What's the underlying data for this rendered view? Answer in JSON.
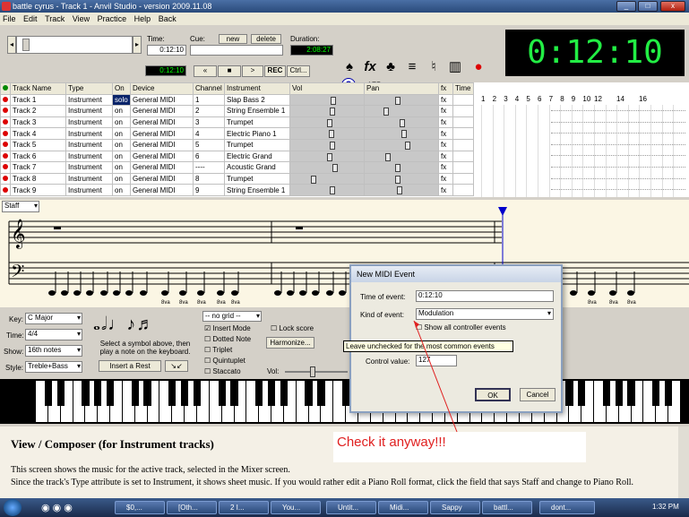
{
  "window": {
    "title": "battle cyrus - Track 1 - Anvil Studio - version 2009.11.08"
  },
  "menu": [
    "File",
    "Edit",
    "Track",
    "View",
    "Practice",
    "Help",
    "Back"
  ],
  "transport": {
    "time_label": "Time:",
    "time_value": "0:12:10",
    "cue_label": "Cue:",
    "cue_new": "new",
    "cue_delete": "delete",
    "duration_label": "Duration:",
    "duration_value": "2:08:27",
    "position_value": "0:12:10",
    "buttons": [
      "«",
      "■",
      ">",
      "REC",
      "Ctrl..."
    ],
    "tempo_value": "175",
    "tempo_label": "tempo",
    "big_clock": "0:12:10"
  },
  "mixer": {
    "headers": [
      "Track Name",
      "Type",
      "On",
      "Device",
      "Channel",
      "Instrument",
      "Vol",
      "Pan",
      "fx",
      "Time"
    ],
    "measures": [
      "1",
      "2",
      "3",
      "4",
      "5",
      "6",
      "7",
      "8",
      "9",
      "10",
      "12",
      "14",
      "16"
    ],
    "rows": [
      {
        "name": "Track 1",
        "type": "Instrument",
        "on": "solo",
        "device": "General MIDI",
        "channel": "1",
        "instrument": "Slap Bass 2",
        "fx": "fx",
        "vol": 0.6,
        "pan": 0.45
      },
      {
        "name": "Track 2",
        "type": "Instrument",
        "on": "on",
        "device": "General MIDI",
        "channel": "2",
        "instrument": "String Ensemble 1",
        "fx": "fx",
        "vol": 0.58,
        "pan": 0.28
      },
      {
        "name": "Track 3",
        "type": "Instrument",
        "on": "on",
        "device": "General MIDI",
        "channel": "3",
        "instrument": "Trumpet",
        "fx": "fx",
        "vol": 0.55,
        "pan": 0.52
      },
      {
        "name": "Track 4",
        "type": "Instrument",
        "on": "on",
        "device": "General MIDI",
        "channel": "4",
        "instrument": "Electric Piano 1",
        "fx": "fx",
        "vol": 0.57,
        "pan": 0.55
      },
      {
        "name": "Track 5",
        "type": "Instrument",
        "on": "on",
        "device": "General MIDI",
        "channel": "5",
        "instrument": "Trumpet",
        "fx": "fx",
        "vol": 0.58,
        "pan": 0.6
      },
      {
        "name": "Track 6",
        "type": "Instrument",
        "on": "on",
        "device": "General MIDI",
        "channel": "6",
        "instrument": "Electric Grand",
        "fx": "fx",
        "vol": 0.55,
        "pan": 0.3
      },
      {
        "name": "Track 7",
        "type": "Instrument",
        "on": "on",
        "device": "General MIDI",
        "channel": "----",
        "instrument": "Acoustic Grand",
        "fx": "fx",
        "vol": 0.62,
        "pan": 0.45
      },
      {
        "name": "Track 8",
        "type": "Instrument",
        "on": "on",
        "device": "General MIDI",
        "channel": "8",
        "instrument": "Trumpet",
        "fx": "fx",
        "vol": 0.3,
        "pan": 0.45
      },
      {
        "name": "Track 9",
        "type": "Instrument",
        "on": "on",
        "device": "General MIDI",
        "channel": "9",
        "instrument": "String Ensemble 1",
        "fx": "fx",
        "vol": 0.58,
        "pan": 0.48
      }
    ]
  },
  "staff": {
    "view_select": "Staff",
    "ottava": "8va"
  },
  "composer": {
    "key_label": "Key:",
    "key_value": "C Major",
    "time_label": "Time:",
    "time_value": "4/4",
    "show_label": "Show:",
    "show_value": "16th notes",
    "style_label": "Style:",
    "style_value": "Treble+Bass",
    "symbol_hint": "Select a symbol above, then play a note on the keyboard.",
    "insert_rest": "Insert a Rest",
    "grid_value": "-- no grid --",
    "lock_score": "Lock score",
    "insert_mode": "Insert Mode",
    "dotted_note": "Dotted Note",
    "triplet": "Triplet",
    "quintuplet": "Quintuplet",
    "staccato": "Staccato",
    "harmonize": "Harmonize...",
    "vol_label": "Vol:"
  },
  "dialog": {
    "title": "New MIDI Event",
    "time_label": "Time of event:",
    "time_value": "0:12:10",
    "kind_label": "Kind of event:",
    "kind_value": "Modulation",
    "show_controller": "Show all controller events",
    "control_label": "Control value:",
    "control_value": "127",
    "ok": "OK",
    "cancel": "Cancel"
  },
  "tooltip": "Leave unchecked for the most common events",
  "callout": "Check it anyway!!!",
  "help": {
    "heading": "View / Composer (for Instrument tracks)",
    "para1": "This screen shows the music for the active track, selected in the Mixer screen.",
    "para2": "Since the track's Type attribute is set to Instrument, it shows sheet music. If you would rather edit a Piano Roll format, click the field that says Staff and change to Piano Roll."
  },
  "taskbar": {
    "tasks": [
      "$0,...",
      "[Oth...",
      "2 I...",
      "You...",
      "Untit...",
      "Midi...",
      "Sappy",
      "battl...",
      "dont..."
    ],
    "clock": "1:32 PM"
  }
}
